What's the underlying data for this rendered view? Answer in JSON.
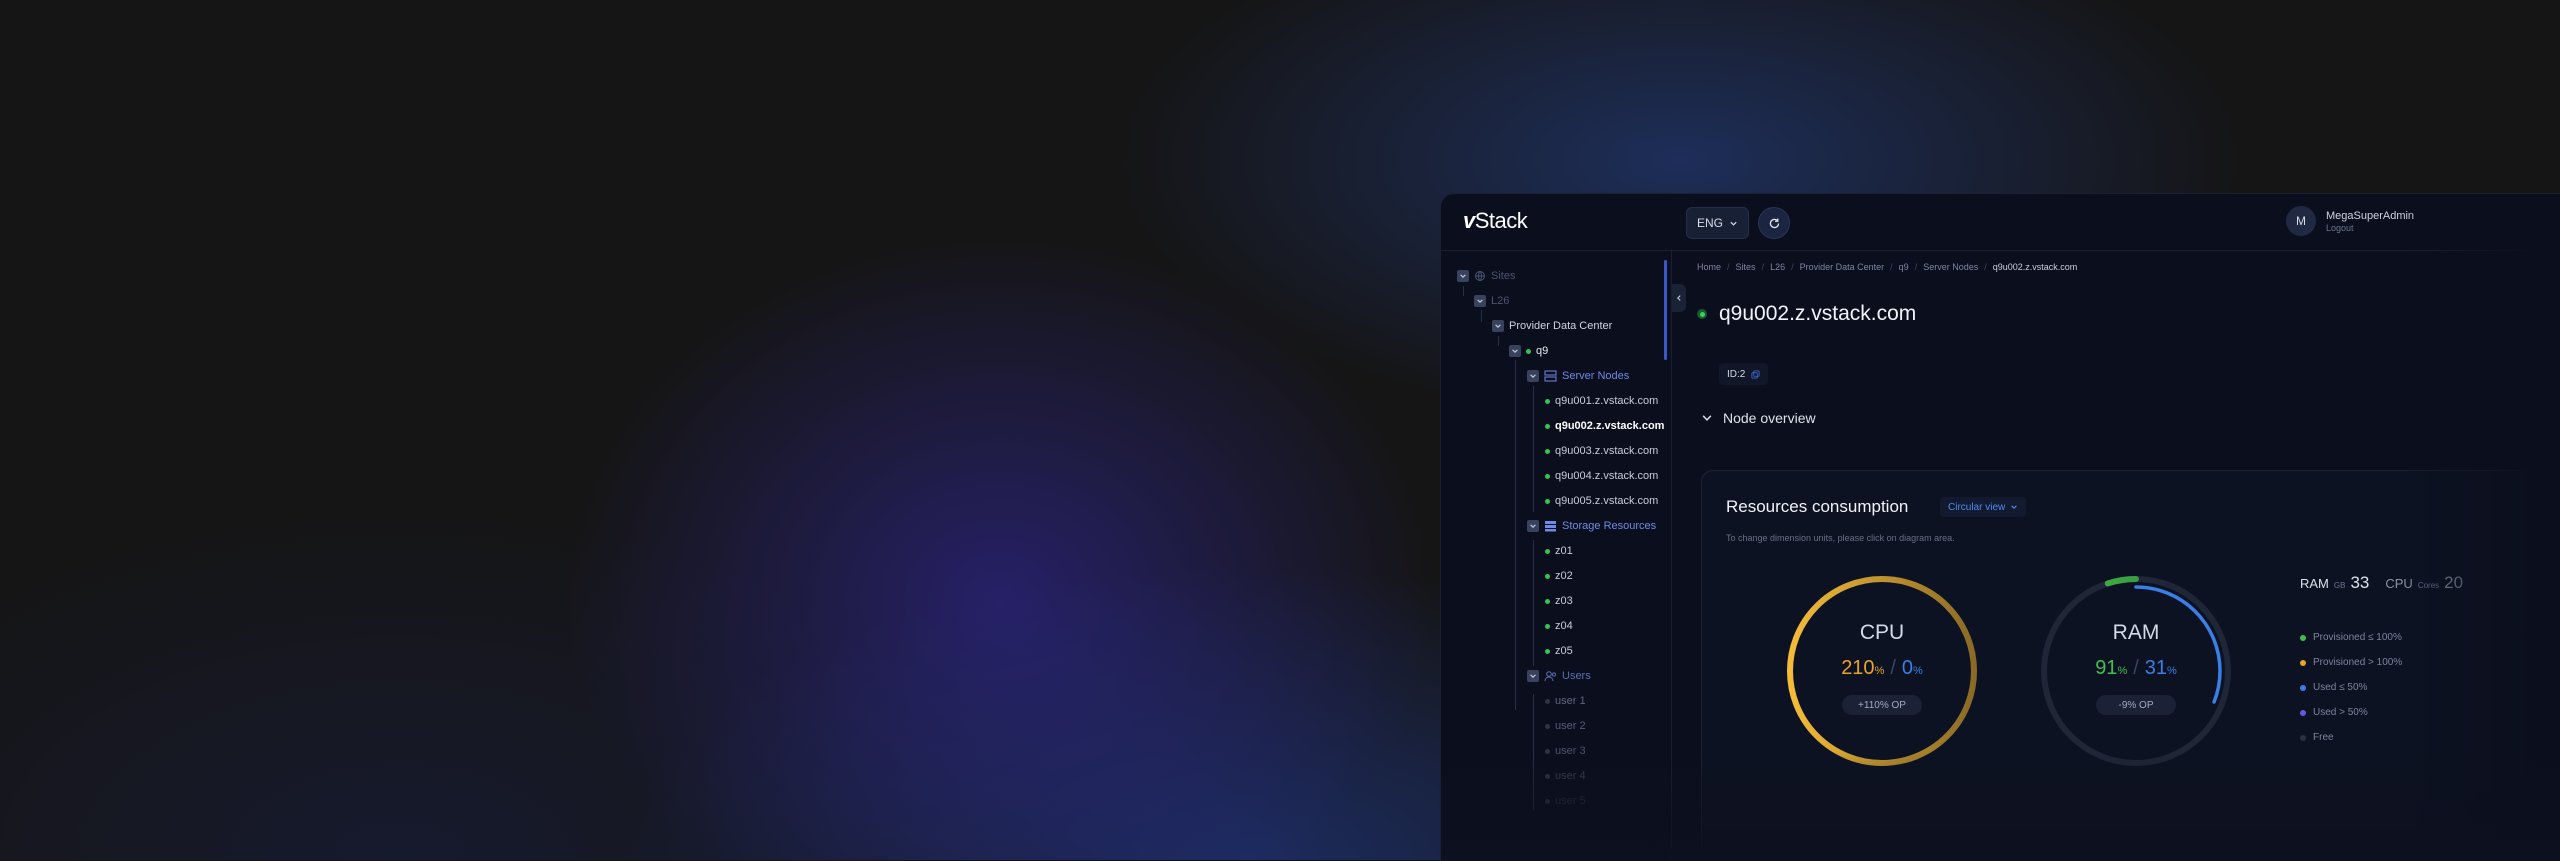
{
  "app": {
    "logo": "vStack",
    "language": "ENG",
    "user": {
      "initial": "M",
      "name": "MegaSuperAdmin",
      "logout": "Logout"
    }
  },
  "tree": {
    "root": "Sites",
    "site": "L26",
    "datacenter": "Provider Data Center",
    "cluster": "q9",
    "server_group": "Server Nodes",
    "servers": [
      "q9u001.z.vstack.com",
      "q9u002.z.vstack.com",
      "q9u003.z.vstack.com",
      "q9u004.z.vstack.com",
      "q9u005.z.vstack.com"
    ],
    "storage_group": "Storage Resources",
    "storages": [
      "z01",
      "z02",
      "z03",
      "z04",
      "z05"
    ],
    "users_group": "Users",
    "users": [
      "user 1",
      "user 2",
      "user 3",
      "user 4",
      "user 5"
    ]
  },
  "breadcrumb": [
    "Home",
    "Sites",
    "L26",
    "Provider Data Center",
    "q9",
    "Server Nodes",
    "q9u002.z.vstack.com"
  ],
  "node": {
    "title": "q9u002.z.vstack.com",
    "id_label": "ID:2",
    "overview_label": "Node overview"
  },
  "resources": {
    "title": "Resources consumption",
    "view_mode": "Circular view",
    "hint": "To change dimension units, please click on diagram area.",
    "cpu": {
      "label": "CPU",
      "provisioned": "210",
      "used": "0",
      "unit": "%",
      "op": "+110% OP",
      "provisioned_fraction": 1.0,
      "used_fraction": 0.0
    },
    "ram": {
      "label": "RAM",
      "provisioned": "91",
      "used": "31",
      "unit": "%",
      "op": "-9% OP",
      "provisioned_fraction": 0.91,
      "used_fraction": 0.31
    },
    "stats": [
      {
        "label": "RAM",
        "unit": "GB",
        "value": "33"
      },
      {
        "label": "CPU",
        "unit": "Cores",
        "value": "20"
      }
    ],
    "legend": [
      {
        "label": "Provisioned ≤ 100%",
        "color": "#3ec04f"
      },
      {
        "label": "Provisioned > 100%",
        "color": "#e7a427"
      },
      {
        "label": "Used ≤ 50%",
        "color": "#3a7fe6"
      },
      {
        "label": "Used > 50%",
        "color": "#6a57e0"
      },
      {
        "label": "Free",
        "color": "#2a3146"
      }
    ]
  },
  "colors": {
    "accent": "#3b6fe3",
    "success": "#39d163",
    "warning": "#f2b53a"
  }
}
